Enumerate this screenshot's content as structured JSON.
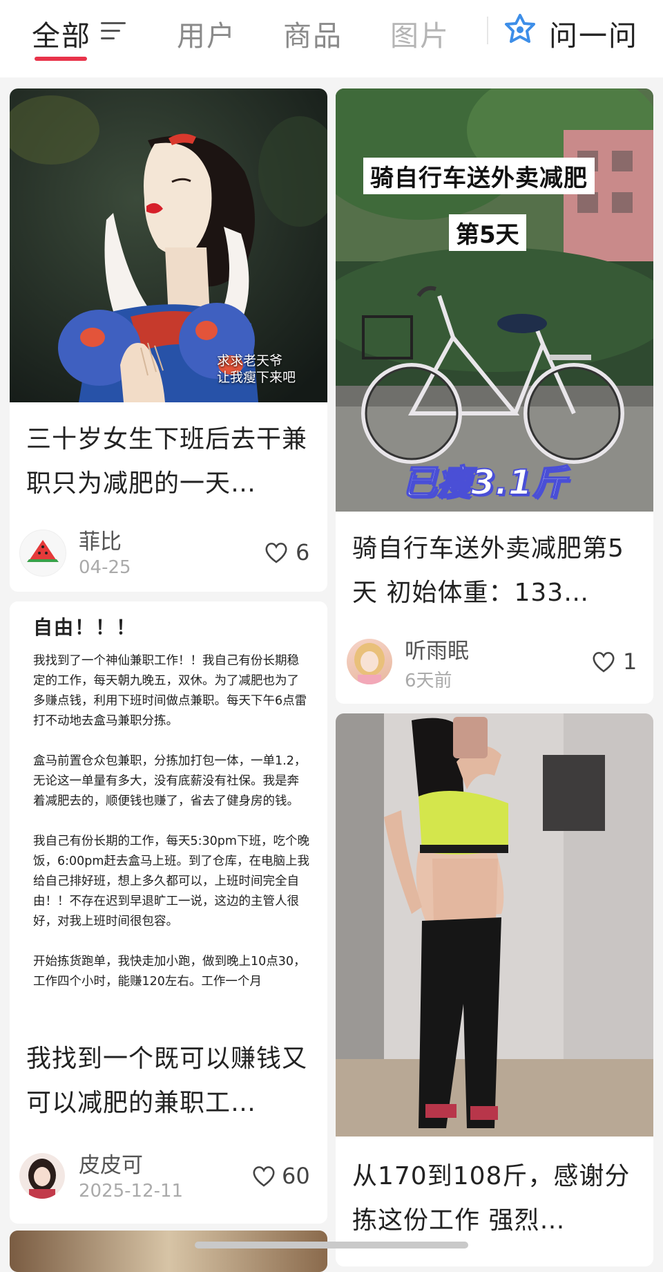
{
  "tabs": [
    {
      "label": "全部"
    },
    {
      "label": "用户"
    },
    {
      "label": "商品"
    },
    {
      "label": "图片"
    }
  ],
  "ask": {
    "label": "问一问"
  },
  "colors": {
    "accent": "#e8334a",
    "ask_icon": "#3d8ee8"
  },
  "cards": [
    {
      "image_caption": "求求老天爷\n让我瘦下来吧",
      "title": "三十岁女生下班后去干兼职只为减肥的一天…",
      "author": "菲比",
      "date": "04-25",
      "likes": "6",
      "avatar_icon": "watermelon-icon"
    },
    {
      "image_overlay_1": "骑自行车送外卖减肥",
      "image_overlay_2": "第5天",
      "image_overlay_3": "已瘦3.1斤",
      "title": "骑自行车送外卖减肥第5天 初始体重：133…",
      "author": "听雨眠",
      "date": "6天前",
      "likes": "1"
    },
    {
      "doc_heading": "自由！！！",
      "doc_paragraphs": [
        "我找到了一个神仙兼职工作！！我自己有份长期稳定的工作，每天朝九晚五，双休。为了减肥也为了多赚点钱，利用下班时间做点兼职。每天下午6点雷打不动地去盒马兼职分拣。",
        "盒马前置仓众包兼职，分拣加打包一体，一单1.2，无论这一单量有多大，没有底薪没有社保。我是奔着减肥去的，顺便钱也赚了，省去了健身房的钱。",
        "我自己有份长期的工作，每天5:30pm下班，吃个晚饭，6:00pm赶去盒马上班。到了仓库，在电脑上我给自己排好班，想上多久都可以，上班时间完全自由！！不存在迟到早退旷工一说，这边的主管人很好，对我上班时间很包容。",
        "开始拣货跑单，我快走加小跑，做到晚上10点30，工作四个小时，能赚120左右。工作一个月"
      ],
      "title": "我找到一个既可以赚钱又可以减肥的兼职工…",
      "author": "皮皮可",
      "date": "2025-12-11",
      "likes": "60"
    },
    {
      "title": "从170到108斤，感谢分拣这份工作 强烈…"
    }
  ]
}
